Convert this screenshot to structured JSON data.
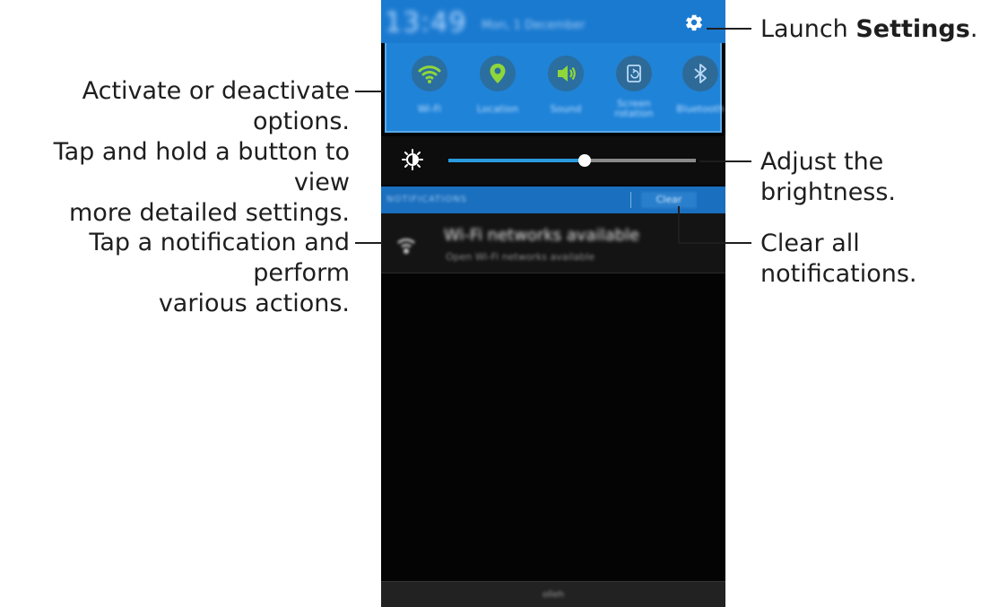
{
  "status_bar": {
    "time": "13:49",
    "date": "Mon, 1 December",
    "settings_icon": "gear-icon"
  },
  "quick_settings": [
    {
      "label": "Wi-Fi",
      "icon": "wifi-icon",
      "active": true
    },
    {
      "label": "Location",
      "icon": "location-pin-icon",
      "active": true
    },
    {
      "label": "Sound",
      "icon": "speaker-icon",
      "active": true
    },
    {
      "label": "Screen rotation",
      "icon": "rotation-icon",
      "active": false
    },
    {
      "label": "Bluetooth",
      "icon": "bluetooth-icon",
      "active": false
    }
  ],
  "brightness": {
    "icon": "brightness-icon",
    "level": 0.55
  },
  "notifications": {
    "header_label": "NOTIFICATIONS",
    "clear_label": "Clear",
    "items": [
      {
        "title": "Wi-Fi networks available",
        "subtitle": "Open Wi-Fi networks available",
        "icon": "wifi-notification-icon"
      }
    ]
  },
  "bottom_bar": {
    "label": "olleh"
  },
  "callouts": {
    "settings": {
      "prefix": "Launch ",
      "bold": "Settings",
      "suffix": "."
    },
    "quick_settings": {
      "line1": "Activate or deactivate options.",
      "line2": "Tap and hold a button to view",
      "line3": "more detailed settings."
    },
    "brightness": "Adjust the brightness.",
    "notification": {
      "line1": "Tap a notification and perform",
      "line2": "various actions."
    },
    "clear": "Clear all notifications."
  },
  "colors": {
    "status_bar": "#1a7ad0",
    "quick_panel": "#1f83d8",
    "active_icon": "#8fd63a",
    "inactive_icon": "#b9d9f7",
    "brightness_fill": "#2a9be0"
  }
}
